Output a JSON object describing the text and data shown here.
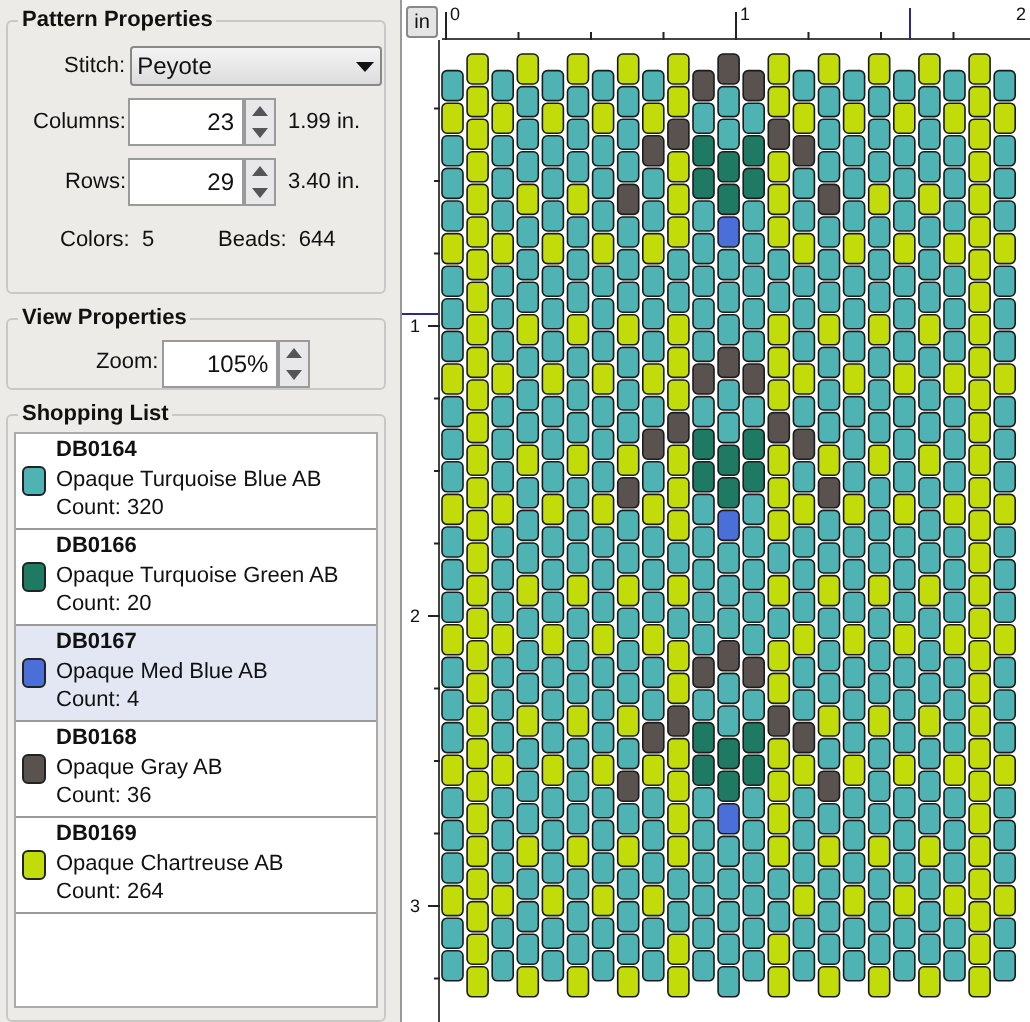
{
  "pattern_properties": {
    "title": "Pattern Properties",
    "stitch": {
      "label": "Stitch:",
      "value": "Peyote"
    },
    "columns": {
      "label": "Columns:",
      "value": "23",
      "size": "1.99 in."
    },
    "rows": {
      "label": "Rows:",
      "value": "29",
      "size": "3.40 in."
    },
    "colors": {
      "label": "Colors:",
      "value": "5"
    },
    "beads": {
      "label": "Beads:",
      "value": "644"
    }
  },
  "view_properties": {
    "title": "View Properties",
    "zoom": {
      "label": "Zoom:",
      "value": "105%"
    }
  },
  "shopping_list": {
    "title": "Shopping List",
    "items": [
      {
        "code": "DB0164",
        "name": "Opaque Turquoise Blue AB",
        "count": "Count: 320",
        "color": "#4fb3b3",
        "selected": false
      },
      {
        "code": "DB0166",
        "name": "Opaque Turquoise Green AB",
        "count": "Count: 20",
        "color": "#1f7a63",
        "selected": false
      },
      {
        "code": "DB0167",
        "name": "Opaque Med Blue AB",
        "count": "Count: 4",
        "color": "#4a6fd8",
        "selected": true
      },
      {
        "code": "DB0168",
        "name": "Opaque Gray AB",
        "count": "Count: 36",
        "color": "#5a524e",
        "selected": false
      },
      {
        "code": "DB0169",
        "name": "Opaque Chartreuse AB",
        "count": "Count: 264",
        "color": "#c2dc0a",
        "selected": false
      }
    ]
  },
  "canvas": {
    "unit_button": "in",
    "x_ruler": [
      "0",
      "1",
      "2"
    ],
    "y_ruler": [
      "1",
      "2",
      "3"
    ]
  }
}
